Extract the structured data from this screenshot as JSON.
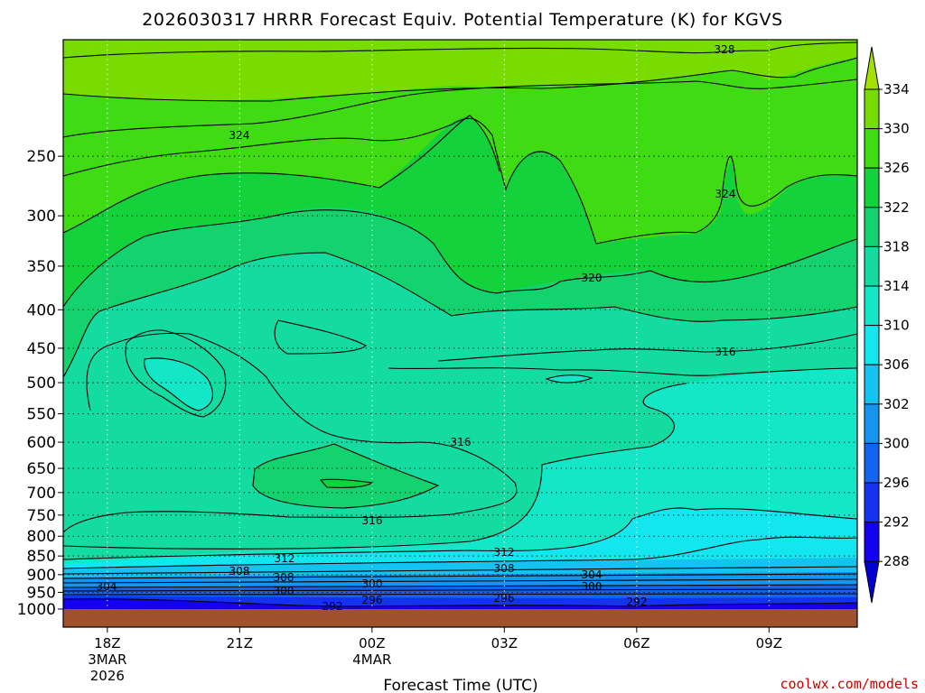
{
  "chart_data": {
    "type": "heatmap",
    "title": "2026030317 HRRR Forecast Equiv. Potential Temperature (K) for KGVS",
    "xlabel": "Forecast Time (UTC)",
    "ylabel": "",
    "x_ticks": [
      {
        "hour": 18,
        "label": "18Z",
        "sub": [
          "3MAR",
          "2026"
        ]
      },
      {
        "hour": 21,
        "label": "21Z",
        "sub": []
      },
      {
        "hour": 24,
        "label": "00Z",
        "sub": [
          "4MAR"
        ]
      },
      {
        "hour": 27,
        "label": "03Z",
        "sub": []
      },
      {
        "hour": 30,
        "label": "06Z",
        "sub": []
      },
      {
        "hour": 33,
        "label": "09Z",
        "sub": []
      }
    ],
    "xlim": [
      17,
      35
    ],
    "y_ticks": [
      250,
      300,
      350,
      400,
      450,
      500,
      550,
      600,
      650,
      700,
      750,
      800,
      850,
      900,
      950,
      1000
    ],
    "ylim": [
      1000,
      175
    ],
    "y_scale": "log",
    "colorbar": {
      "labels": [
        "334",
        "330",
        "326",
        "322",
        "318",
        "314",
        "310",
        "306",
        "302",
        "300",
        "296",
        "292",
        "288"
      ],
      "colors": [
        "#a6e000",
        "#78dc00",
        "#3fdc14",
        "#14d23c",
        "#14d26e",
        "#14dca0",
        "#14e6c8",
        "#14e6f0",
        "#14c3f0",
        "#1496f0",
        "#1464f0",
        "#1432f0",
        "#1400f0",
        "#0000d2"
      ]
    },
    "contour_labels": [
      "328",
      "324",
      "324",
      "320",
      "316",
      "316",
      "316",
      "312",
      "312",
      "308",
      "308",
      "308",
      "304",
      "304",
      "300",
      "300",
      "300",
      "296",
      "296",
      "292",
      "292"
    ],
    "ground_color": "#a0522d",
    "credit": "coolwx.com/models",
    "credit_color": "#cc0000"
  }
}
